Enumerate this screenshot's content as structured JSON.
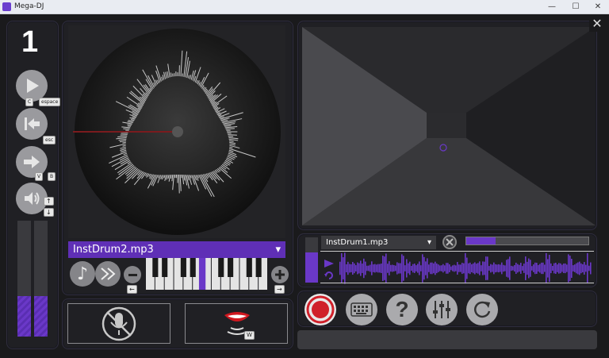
{
  "window": {
    "title": "Mega-DJ",
    "minimize": "—",
    "maximize": "☐",
    "close": "✕"
  },
  "deck1": {
    "number": "1",
    "keys": {
      "play_key1": "C",
      "play_key2": "espace",
      "back_key": "esc",
      "next_key1": "V",
      "next_key2": "B"
    },
    "vol_up": "↑",
    "vol_down": "↓",
    "meter_left_level": 0.35,
    "meter_right_level": 0.35,
    "track": "InstDrum2.mp3",
    "dropdown_arrow": "▾",
    "pitch_left_key": "←",
    "pitch_right_key": "→",
    "voice_key": "W"
  },
  "deck2": {
    "track": "InstDrum1.mp3",
    "dropdown_arrow": "▾",
    "progress": 0.24
  },
  "colors": {
    "accent": "#6a38c8",
    "record": "#d0202a",
    "panel": "#202024"
  }
}
